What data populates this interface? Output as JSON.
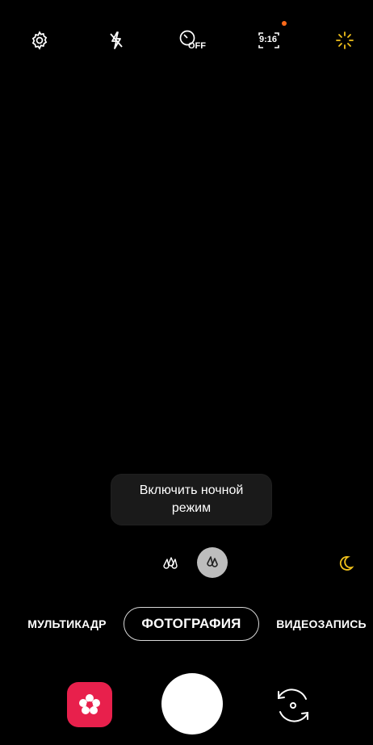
{
  "toolbar": {
    "settings_icon": "gear-icon",
    "flash_icon": "flash-off-icon",
    "timer_icon": "timer-off-icon",
    "timer_badge": "OFF",
    "ratio_label": "9:16",
    "ratio_dot_color": "#ff6a1a",
    "effects_icon": "sparkle-icon",
    "effects_color": "#f2c21b"
  },
  "tooltip": {
    "text": "Включить ночной режим"
  },
  "scene_row": {
    "items": [
      {
        "icon": "wide-angle-icon",
        "active": false
      },
      {
        "icon": "standard-angle-icon",
        "active": true
      }
    ],
    "night_icon": "moon-icon",
    "night_color": "#f2c21b"
  },
  "modes": {
    "items": [
      {
        "label": "МУЛЬТИКАДР",
        "active": false
      },
      {
        "label": "ФОТОГРАФИЯ",
        "active": true
      },
      {
        "label": "ВИДЕОЗАПИСЬ",
        "active": false
      }
    ]
  },
  "bottom": {
    "gallery_icon": "gallery-flower-icon",
    "gallery_color": "#e8204c",
    "shutter_icon": "shutter-button",
    "switch_icon": "switch-camera-icon"
  }
}
